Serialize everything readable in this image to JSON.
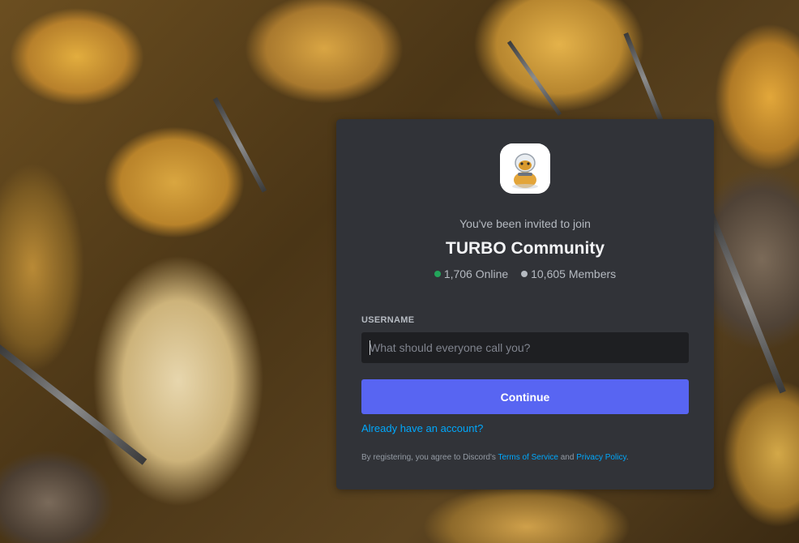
{
  "invite": {
    "intro": "You've been invited to join",
    "server_name": "TURBO Community",
    "online_count": "1,706 Online",
    "member_count": "10,605 Members",
    "icon": "toad-astronaut-server-icon"
  },
  "form": {
    "username_label": "USERNAME",
    "username_placeholder": "What should everyone call you?",
    "username_value": "",
    "continue_label": "Continue",
    "login_link": "Already have an account?"
  },
  "legal": {
    "prefix": "By registering, you agree to Discord's ",
    "terms_label": "Terms of Service",
    "middle": " and ",
    "privacy_label": "Privacy Policy",
    "suffix": "."
  },
  "colors": {
    "card_bg": "#313338",
    "input_bg": "#1e1f22",
    "accent": "#5865f2",
    "link": "#00a8fc",
    "online": "#23a55a"
  }
}
